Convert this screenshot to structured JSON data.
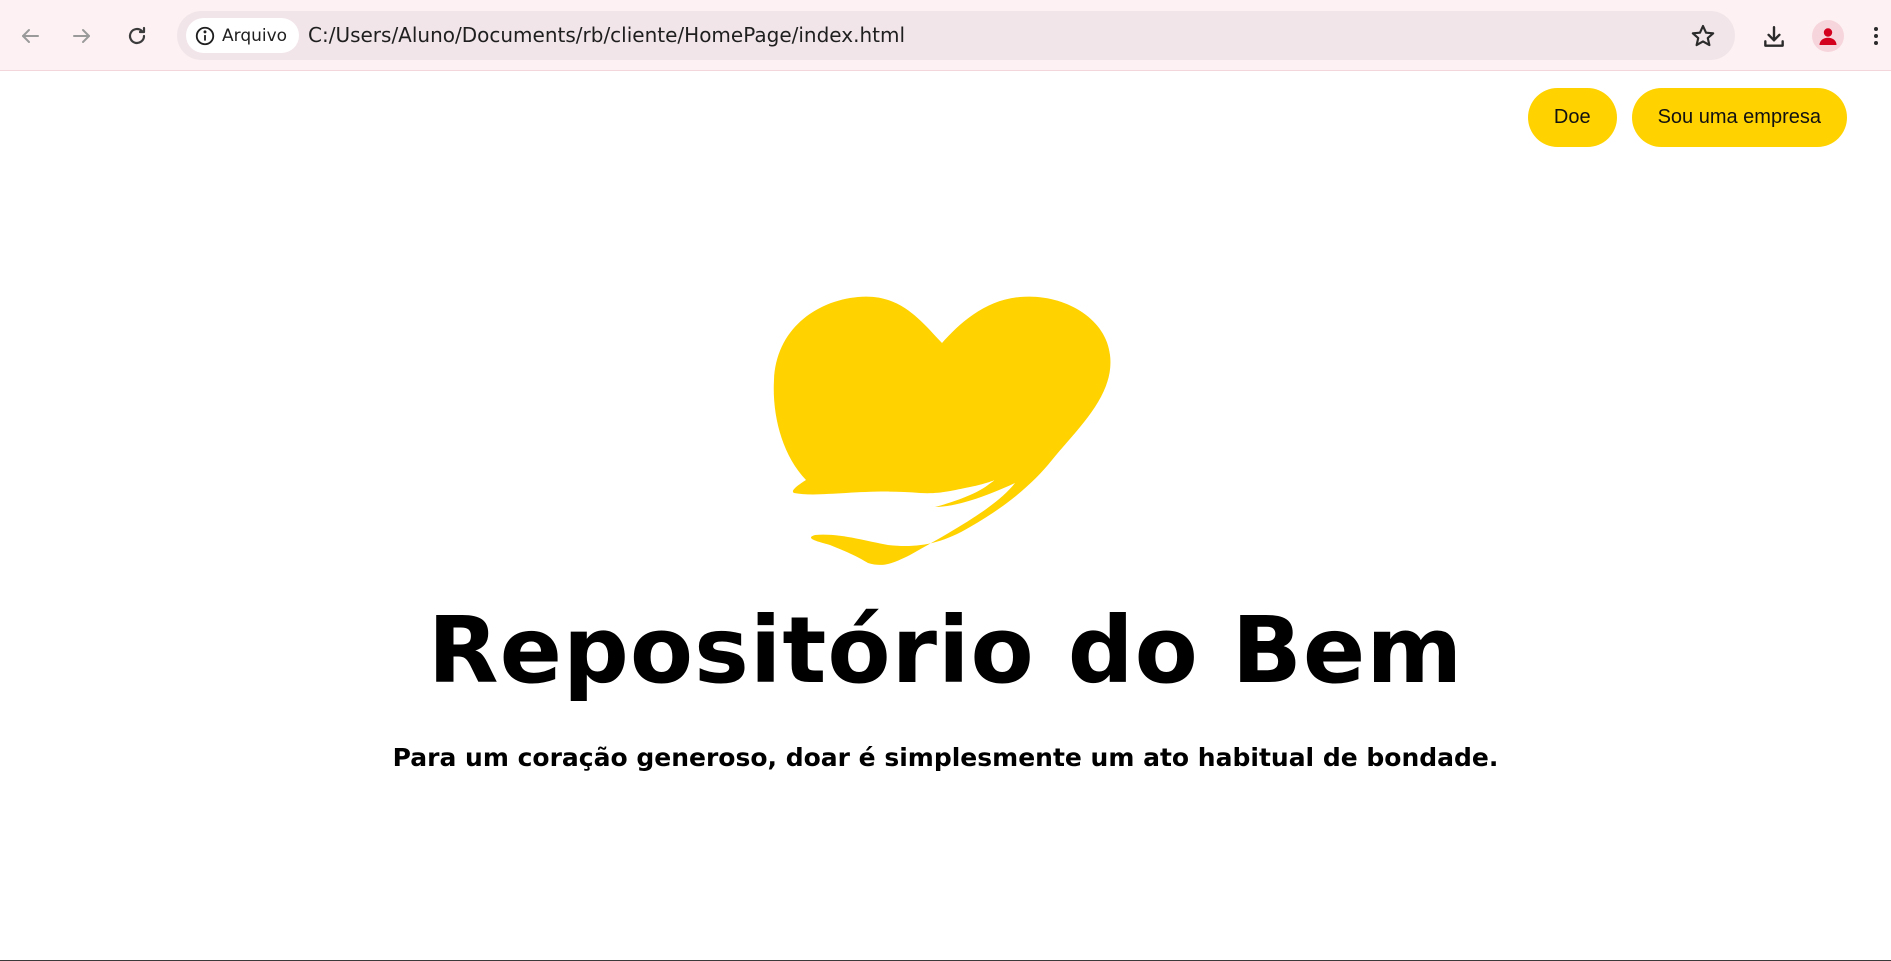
{
  "browser": {
    "origin_chip_label": "Arquivo",
    "url": "C:/Users/Aluno/Documents/rb/cliente/HomePage/index.html",
    "icons": [
      "back-icon",
      "forward-icon",
      "reload-icon",
      "info-icon",
      "star-icon",
      "download-icon",
      "profile-icon",
      "kebab-menu-icon"
    ]
  },
  "header": {
    "donate_label": "Doe",
    "company_label": "Sou uma empresa"
  },
  "hero": {
    "logo_icon": "heart-in-hand-icon",
    "title": "Repositório do Bem",
    "subtitle": "Para um coração generoso, doar é simplesmente um ato habitual de bondade."
  },
  "colors": {
    "accent": "#ffd200",
    "browser_bar": "#fdf1f3",
    "omnibox": "#f2e5e9",
    "text": "#000000"
  }
}
